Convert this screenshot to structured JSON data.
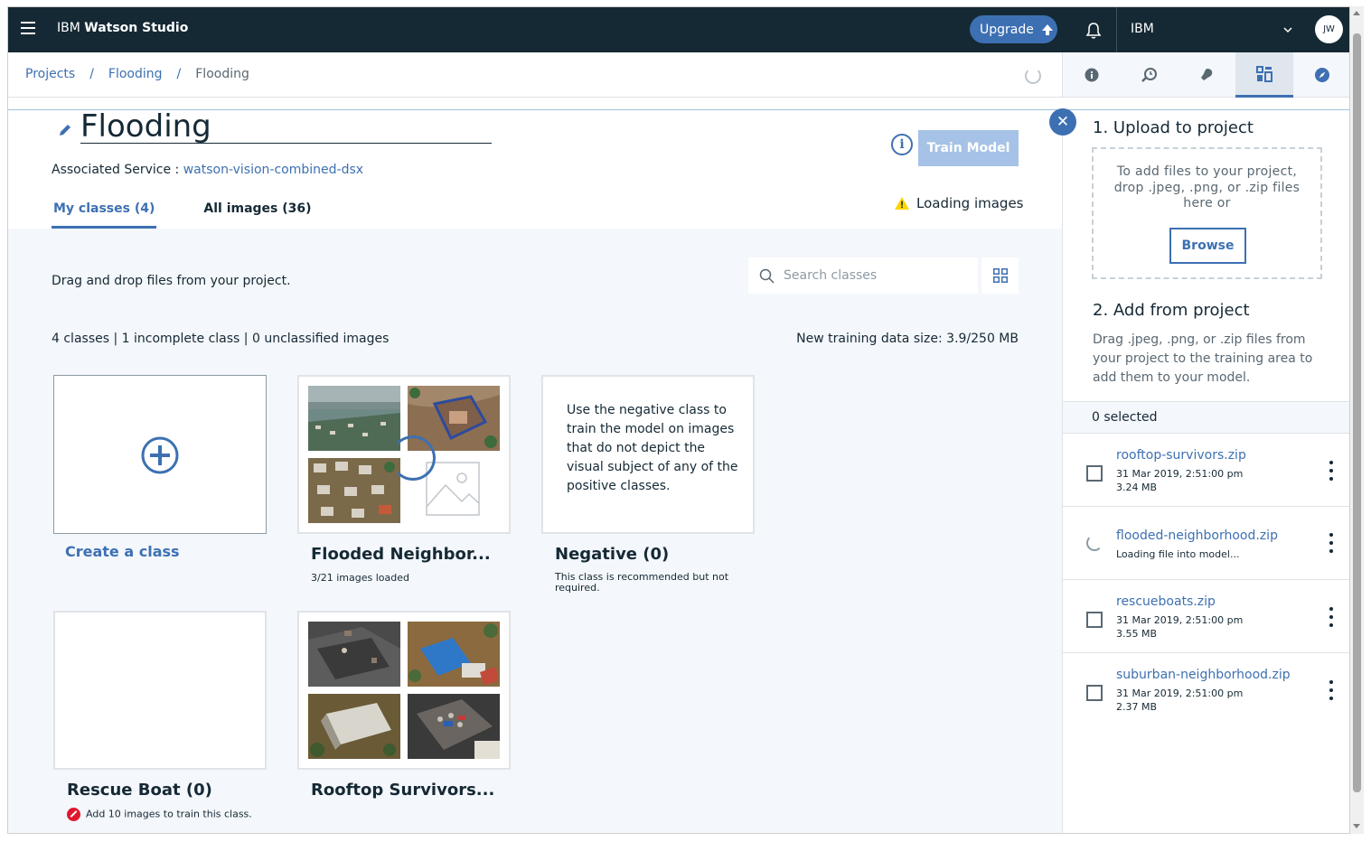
{
  "topbar": {
    "brand_prefix": "IBM",
    "brand_name": "Watson Studio",
    "upgrade_label": "Upgrade",
    "account_name": "IBM",
    "avatar_initials": "JW"
  },
  "breadcrumb": {
    "items": [
      "Projects",
      "Flooding",
      "Flooding"
    ],
    "separator": "/"
  },
  "side_tabs": [
    "info-icon",
    "history-icon",
    "bulb-icon",
    "data-icon",
    "compass-icon"
  ],
  "model": {
    "title": "Flooding",
    "train_label": "Train Model",
    "associated_label": "Associated Service :",
    "associated_service": "watson-vision-combined-dsx"
  },
  "tabs": [
    {
      "label": "My classes (4)",
      "active": true
    },
    {
      "label": "All images (36)",
      "active": false
    }
  ],
  "status": {
    "loading_text": "Loading images"
  },
  "content": {
    "drag_hint": "Drag and drop files from your project.",
    "search_placeholder": "Search classes",
    "counts_text": "4 classes | 1 incomplete class | 0 unclassified images",
    "datasize_label": "New training data size:",
    "datasize_value": "3.9/250 MB"
  },
  "classes": [
    {
      "title": "",
      "create_label": "Create a class"
    },
    {
      "title": "Flooded Neighbor...",
      "subtitle": "3/21 images loaded"
    },
    {
      "title": "Negative (0)",
      "description": "Use the negative class to train the model on images that do not depict the visual subject of any of the positive classes.",
      "subtitle": "This class is recommended but not required."
    },
    {
      "title": "Rescue Boat (0)",
      "subtitle": "Add 10 images to train this class."
    },
    {
      "title": "Rooftop Survivors...",
      "subtitle": ""
    }
  ],
  "panel": {
    "upload_heading": "1. Upload to project",
    "dropzone_text": "To add files to your project, drop .jpeg, .png, or .zip files here or",
    "browse_label": "Browse",
    "add_heading": "2. Add from project",
    "add_description": "Drag .jpeg, .png, or .zip files from your project to the training area to add them to your model.",
    "selected_text": "0 selected",
    "files": [
      {
        "name": "rooftop-survivors.zip",
        "date": "31 Mar 2019, 2:51:00 pm",
        "size": "3.24 MB",
        "loading": false
      },
      {
        "name": "flooded-neighborhood.zip",
        "status": "Loading file into model...",
        "loading": true
      },
      {
        "name": "rescueboats.zip",
        "date": "31 Mar 2019, 2:51:00 pm",
        "size": "3.55 MB",
        "loading": false
      },
      {
        "name": "suburban-neighborhood.zip",
        "date": "31 Mar 2019, 2:51:00 pm",
        "size": "2.37 MB",
        "loading": false
      }
    ]
  },
  "colors": {
    "topbar": "#152934",
    "accent": "#3d70b2",
    "train_disabled": "#a6c2e6",
    "content_bg": "#f4f7fb",
    "error": "#e0182d",
    "warning": "#fdd600"
  }
}
